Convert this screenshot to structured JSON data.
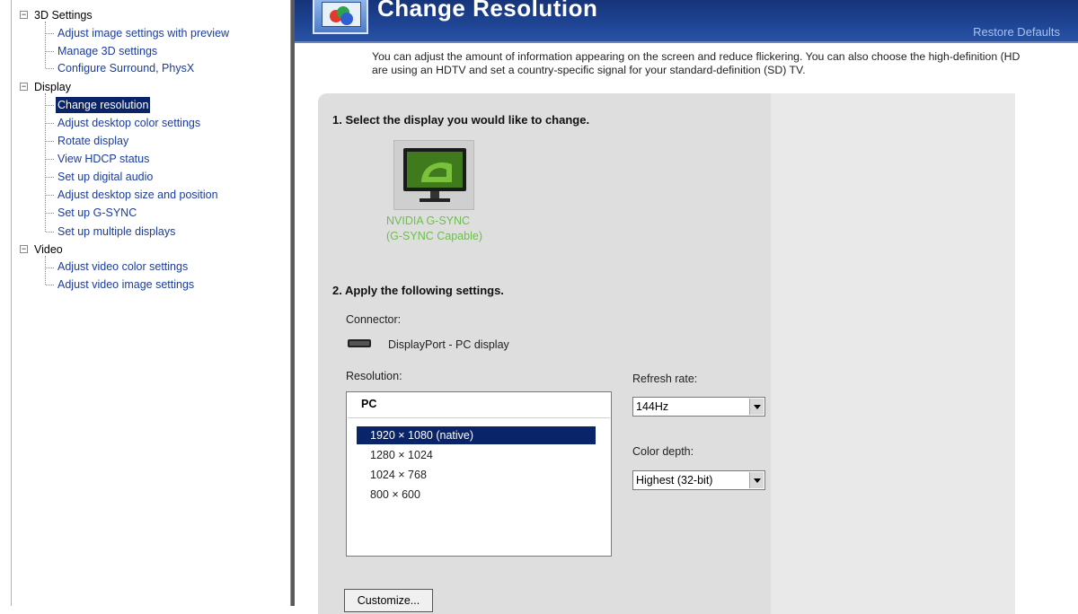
{
  "tree": {
    "categories": [
      {
        "label": "3D Settings",
        "toggle": "−",
        "items": [
          "Adjust image settings with preview",
          "Manage 3D settings",
          "Configure Surround, PhysX"
        ]
      },
      {
        "label": "Display",
        "toggle": "−",
        "items": [
          "Change resolution",
          "Adjust desktop color settings",
          "Rotate display",
          "View HDCP status",
          "Set up digital audio",
          "Adjust desktop size and position",
          "Set up G-SYNC",
          "Set up multiple displays"
        ]
      },
      {
        "label": "Video",
        "toggle": "−",
        "items": [
          "Adjust video color settings",
          "Adjust video image settings"
        ]
      }
    ],
    "selected_item": "Change resolution"
  },
  "page": {
    "title": "Change Resolution",
    "restore_defaults": "Restore Defaults",
    "description_line1": "You can adjust the amount of information appearing on the screen and reduce flickering. You can also choose the high-definition (HD",
    "description_line2": "are using an HDTV and set a country-specific signal for your standard-definition (SD) TV."
  },
  "step1": {
    "heading": "1. Select the display you would like to change.",
    "display_name_line1": "NVIDIA G-SYNC",
    "display_name_line2": "(G-SYNC Capable)"
  },
  "step2": {
    "heading": "2. Apply the following settings.",
    "connector_label": "Connector:",
    "connector_value": "DisplayPort - PC display",
    "resolution_label": "Resolution:",
    "resolution_group": "PC",
    "resolutions": [
      "1920 × 1080 (native)",
      "1280 × 1024",
      "1024 × 768",
      "800 × 600"
    ],
    "selected_resolution": "1920 × 1080 (native)",
    "refresh_rate_label": "Refresh rate:",
    "refresh_rate_value": "144Hz",
    "color_depth_label": "Color depth:",
    "color_depth_value": "Highest (32-bit)",
    "customize_button": "Customize..."
  },
  "colors": {
    "banner": "#1f4594",
    "selection": "#0a246a",
    "link": "#1a3c9e",
    "display_name": "#6cc04a"
  },
  "icons": {
    "banner": "nvidia-display-icon",
    "monitor": "monitor-nvidia-icon",
    "connector": "displayport-connector-icon"
  }
}
